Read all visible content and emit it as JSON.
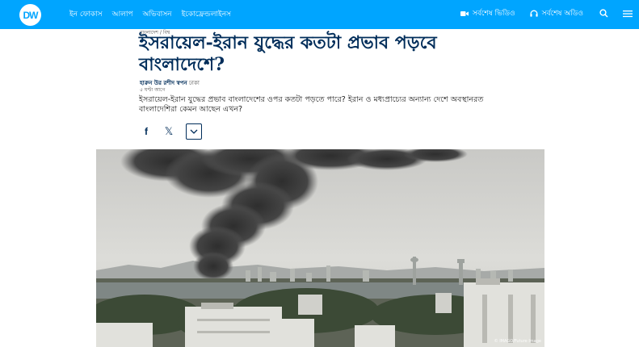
{
  "header": {
    "logo_text": "DW",
    "nav_items": [
      "ইন ফোকাস",
      "আলাপ",
      "অভিবাসন",
      "ইকোফ্রেন্ডলাইনস"
    ],
    "latest_video_label": "সর্বশেষ ভিডিও",
    "latest_audio_label": "সর্বশেষ অডিও",
    "accent_color": "#00a5ff"
  },
  "article": {
    "kicker": "বাংলাদেশ / বিশ্ব",
    "headline": "ইসরায়েল-ইরান যুদ্ধের কতটা প্রভাব পড়বে বাংলাদেশে?",
    "author": "হারুন উর রশীদ স্বপন",
    "location": "ঢাকা",
    "time": "৫ ঘণ্টা আগে",
    "summary": "ইসরায়েল-ইরান যুদ্ধের প্রভাব বাংলাদেশের ওপর কতটা পড়তে পারে? ইরান ও মধ্যপ্রাচ্যের অন্যান্য দেশে অবস্থানরত বাংলাদেশিরা কেমন আছেন এখন?",
    "headline_color": "#002d5a"
  },
  "share": {
    "facebook_icon": "f",
    "x_icon": "𝕏"
  },
  "image": {
    "credit": "© IMAGO/Future Image"
  }
}
